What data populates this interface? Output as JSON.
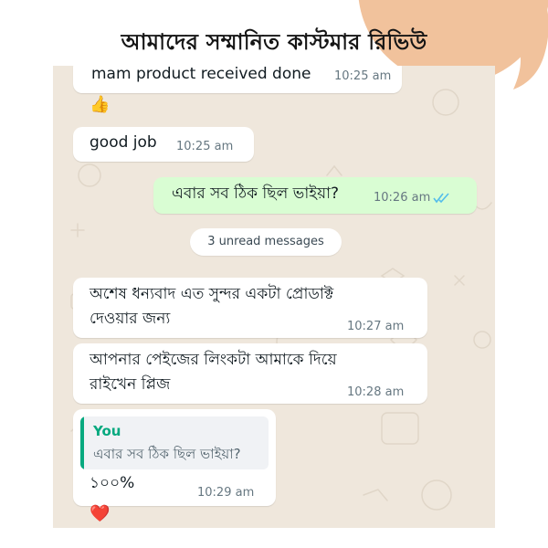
{
  "banner": {
    "title": "আমাদের সম্মানিত কাস্টমার রিভিউ"
  },
  "colors": {
    "chat_background": "#efe7dc",
    "incoming_bubble": "#ffffff",
    "outgoing_bubble": "#d9fdd3",
    "read_ticks": "#53bdeb",
    "quote_accent": "#06a97f",
    "decoration": "#f1c29c"
  },
  "messages": [
    {
      "direction": "incoming",
      "lines": [
        "mam product received done"
      ],
      "time": "10:25 am",
      "reaction": "👍",
      "reaction_icon": "thumbs-up-icon"
    },
    {
      "direction": "incoming",
      "lines": [
        "good job"
      ],
      "time": "10:25 am"
    },
    {
      "direction": "outgoing",
      "lines": [
        "এবার সব ঠিক ছিল ভাইয়া?"
      ],
      "time": "10:26 am",
      "status": "read"
    },
    {
      "direction": "incoming",
      "lines": [
        "অশেষ ধন্যবাদ এত সুন্দর একটা প্রোডাক্ট",
        "দেওয়ার জন্য"
      ],
      "time": "10:27 am"
    },
    {
      "direction": "incoming",
      "lines": [
        "আপনার পেইজের লিংকটা আমাকে  দিয়ে",
        "রাইখেন প্লিজ"
      ],
      "time": "10:28 am"
    },
    {
      "direction": "incoming",
      "quote": {
        "author": "You",
        "text": "এবার সব ঠিক ছিল ভাইয়া?"
      },
      "lines": [
        "১০০%"
      ],
      "time": "10:29 am",
      "reaction": "❤️",
      "reaction_icon": "heart-icon"
    }
  ],
  "unread_divider": "3 unread messages"
}
